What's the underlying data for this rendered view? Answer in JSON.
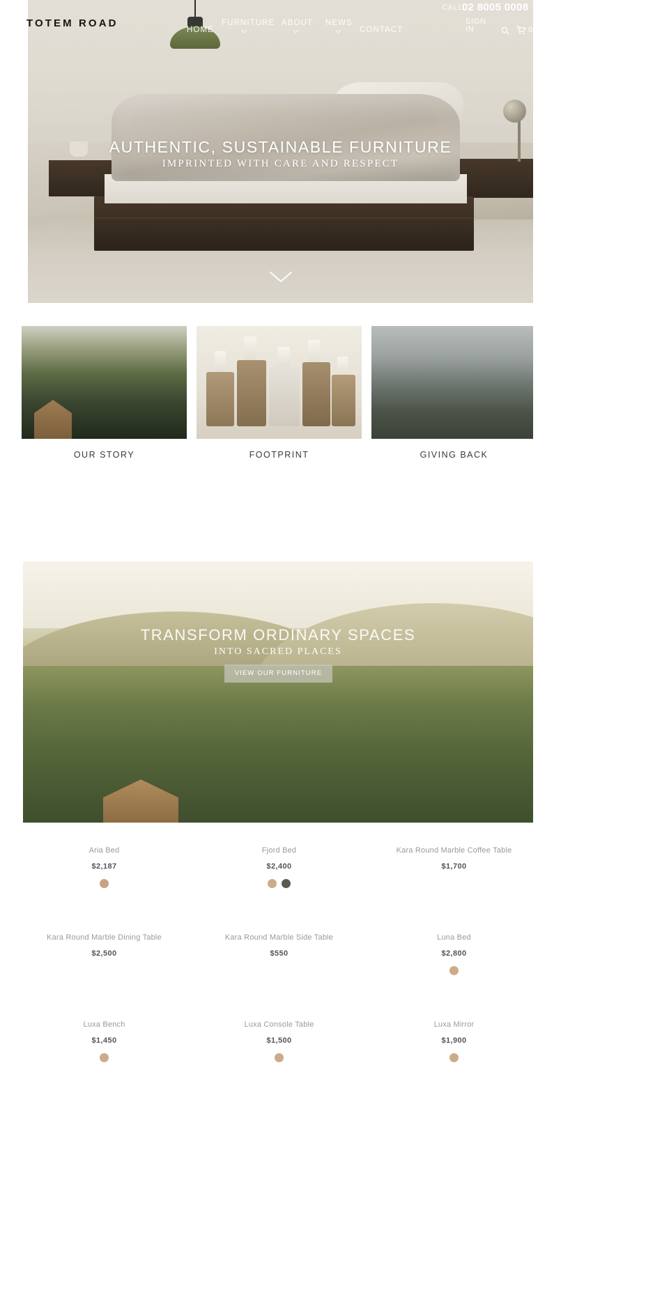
{
  "site": {
    "logo": "TOTEM ROAD"
  },
  "header": {
    "nav": [
      {
        "label": "HOME",
        "has_dropdown": false
      },
      {
        "label": "FURNITURE",
        "has_dropdown": true
      },
      {
        "label": "ABOUT",
        "has_dropdown": true
      },
      {
        "label": "NEWS",
        "has_dropdown": true
      },
      {
        "label": "CONTACT",
        "has_dropdown": false
      }
    ],
    "call_label": "CALL",
    "call_number": "02 8005 0008",
    "sign_in": "SIGN IN",
    "search_icon": "search-icon",
    "cart_icon": "cart-icon",
    "cart_count": "0"
  },
  "hero": {
    "title": "AUTHENTIC, SUSTAINABLE FURNITURE",
    "subtitle": "IMPRINTED WITH CARE AND RESPECT",
    "scroll_icon": "chevron-down-icon"
  },
  "categories": [
    {
      "label": "OUR STORY",
      "image": "forest-cabin-photo"
    },
    {
      "label": "FOOTPRINT",
      "image": "wood-log-candles-photo"
    },
    {
      "label": "GIVING BACK",
      "image": "misty-cliff-photo"
    }
  ],
  "banner": {
    "title": "TRANSFORM ORDINARY SPACES",
    "subtitle": "INTO SACRED PLACES",
    "button_label": "VIEW OUR FURNITURE",
    "image": "forest-hills-cabin-photo"
  },
  "products": [
    [
      {
        "name": "Aria Bed",
        "price": "$2,187",
        "swatches": [
          "#c8a383"
        ]
      },
      {
        "name": "Fjord Bed",
        "price": "$2,400",
        "swatches": [
          "#ceab89",
          "#5a5a53"
        ]
      },
      {
        "name": "Kara Round Marble Coffee Table",
        "price": "$1,700",
        "swatches": []
      }
    ],
    [
      {
        "name": "Kara Round Marble Dining Table",
        "price": "$2,500",
        "swatches": []
      },
      {
        "name": "Kara Round Marble Side Table",
        "price": "$550",
        "swatches": []
      },
      {
        "name": "Luna Bed",
        "price": "$2,800",
        "swatches": [
          "#cdab8a"
        ]
      }
    ],
    [
      {
        "name": "Luxa Bench",
        "price": "$1,450",
        "swatches": [
          "#cdab8a"
        ]
      },
      {
        "name": "Luxa Console Table",
        "price": "$1,500",
        "swatches": [
          "#cdab8a"
        ]
      },
      {
        "name": "Luxa Mirror",
        "price": "$1,900",
        "swatches": [
          "#cdab8a"
        ]
      }
    ]
  ],
  "colors": {
    "text_dark": "#3a3a36",
    "text_muted": "#9a9a98",
    "price": "#55555a",
    "swatch_tan": "#cdab8a",
    "swatch_charcoal": "#5a5a53"
  }
}
